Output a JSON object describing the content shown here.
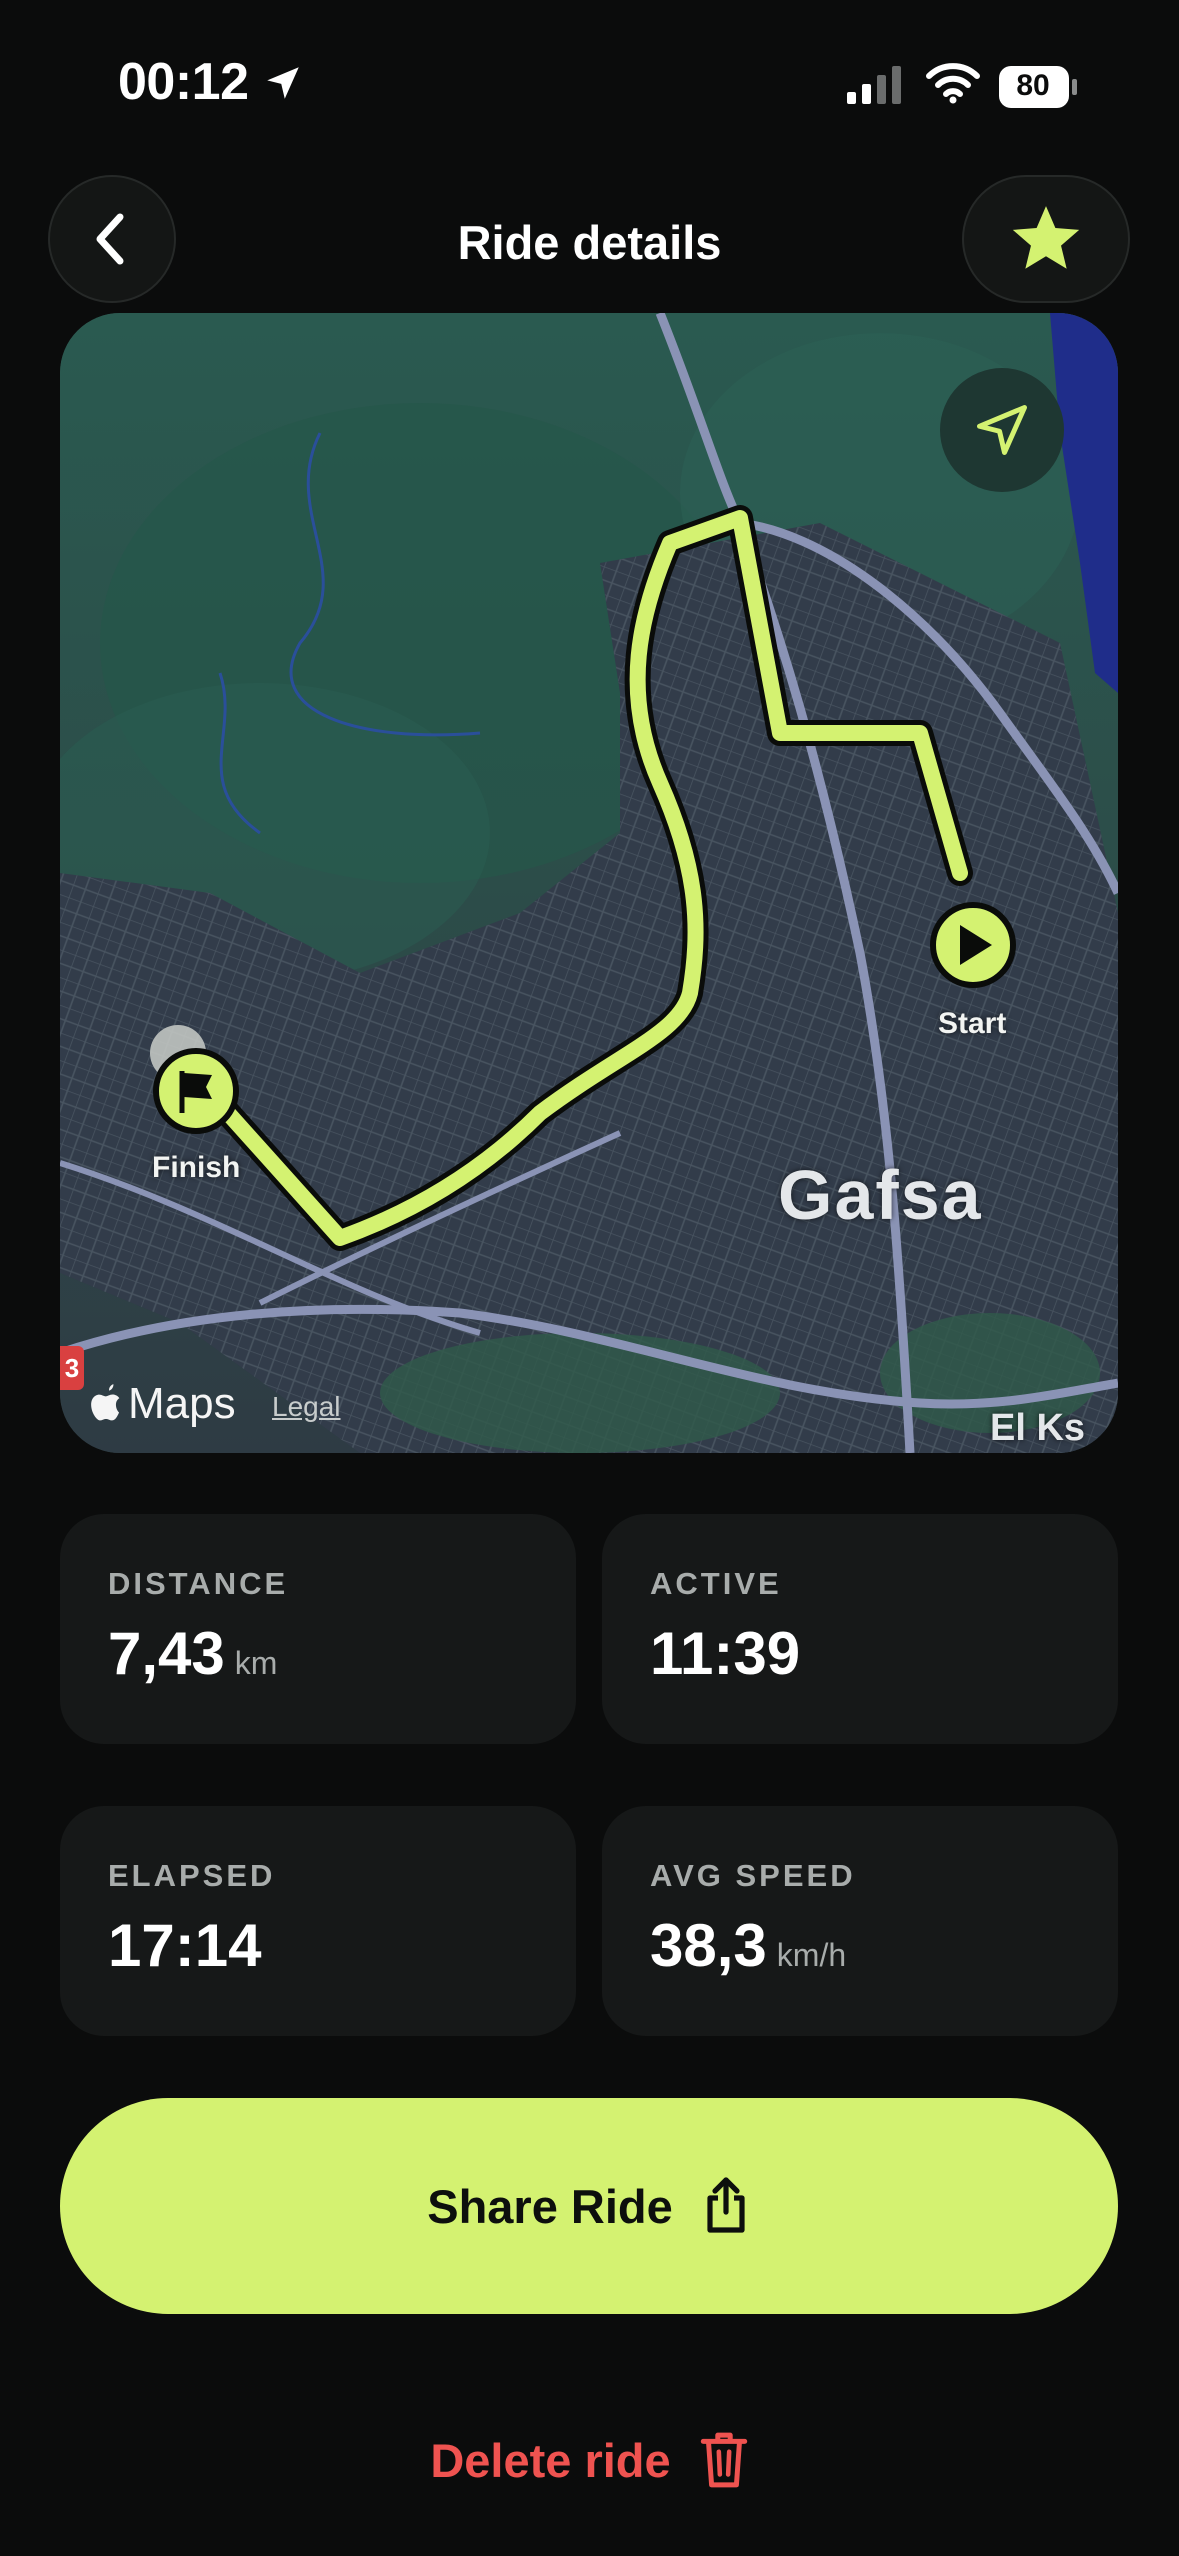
{
  "status_bar": {
    "time": "00:12",
    "battery": "80"
  },
  "header": {
    "title": "Ride details"
  },
  "map": {
    "start_label": "Start",
    "finish_label": "Finish",
    "city_label": "Gafsa",
    "edge_label": "El Ks",
    "maps_brand": "Maps",
    "legal_label": "Legal",
    "road_badge": "3"
  },
  "stats": {
    "distance": {
      "label": "DISTANCE",
      "value": "7,43",
      "unit": "km"
    },
    "active": {
      "label": "ACTIVE",
      "value": "11:39"
    },
    "elapsed": {
      "label": "ELAPSED",
      "value": "17:14"
    },
    "avg_speed": {
      "label": "AVG SPEED",
      "value": "38,3",
      "unit": "km/h"
    }
  },
  "actions": {
    "share_label": "Share Ride",
    "delete_label": "Delete ride"
  },
  "colors": {
    "accent": "#d4f271",
    "danger": "#ef5350",
    "background": "#0b0c0c",
    "card": "#161818"
  }
}
